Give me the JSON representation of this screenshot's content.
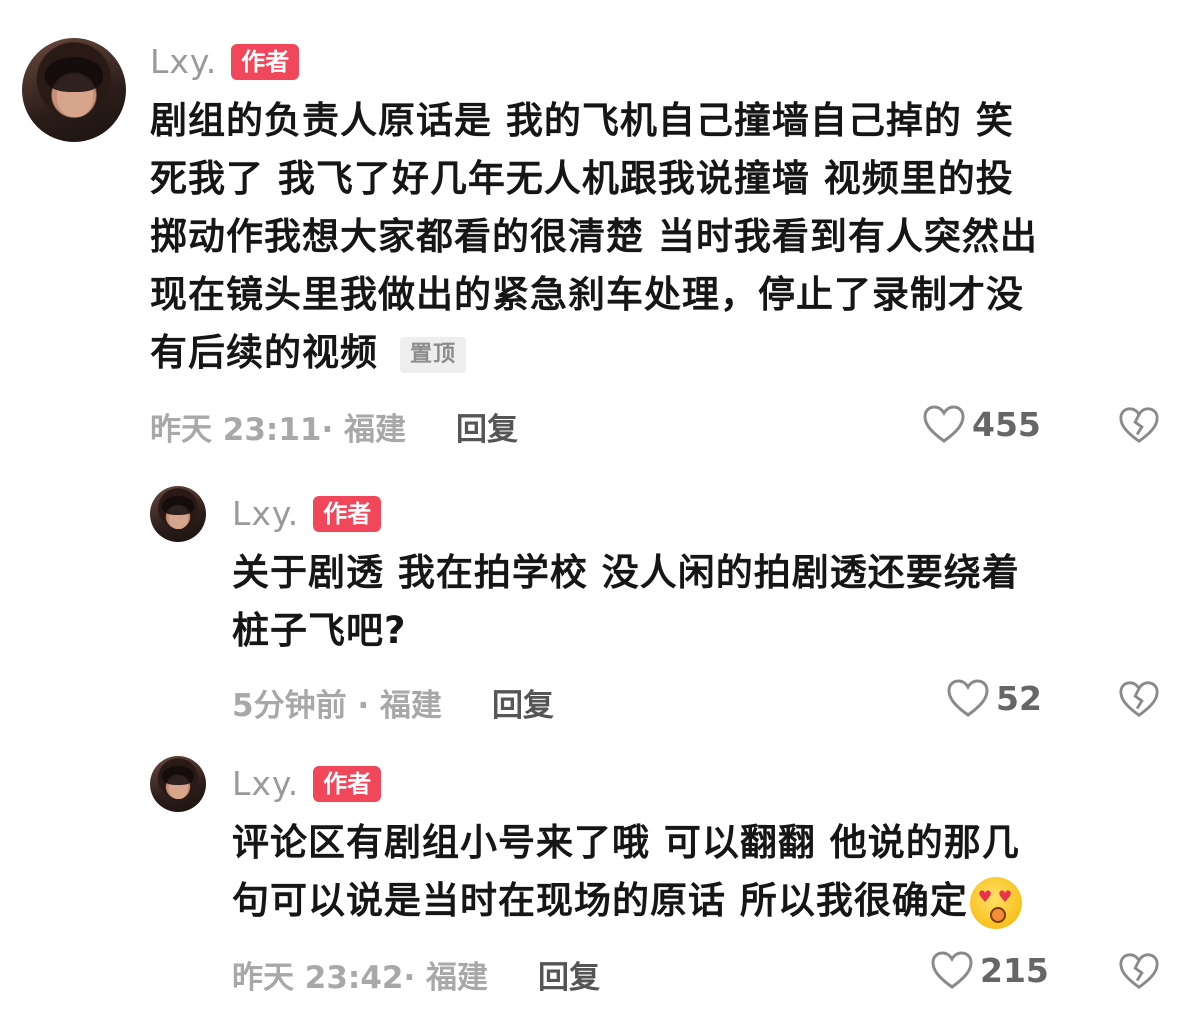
{
  "comments": [
    {
      "username": "Lxy.",
      "author_badge": "作者",
      "lines": [
        "剧组的负责人原话是 我的飞机自己撞墙自己掉的 笑",
        "死我了 我飞了好几年无人机跟我说撞墙 视频里的投",
        "掷动作我想大家都看的很清楚 当时我看到有人突然出",
        "现在镜头里我做出的紧急刹车处理，停止了录制才没",
        "有后续的视频"
      ],
      "pin_badge": "置顶",
      "meta": "昨天 23:11· 福建",
      "reply_label": "回复",
      "likes": "455"
    },
    {
      "username": "Lxy.",
      "author_badge": "作者",
      "lines": [
        "关于剧透 我在拍学校 没人闲的拍剧透还要绕着",
        "桩子飞吧?"
      ],
      "meta": "5分钟前 · 福建",
      "reply_label": "回复",
      "likes": "52"
    },
    {
      "username": "Lxy.",
      "author_badge": "作者",
      "lines": [
        "评论区有剧组小号来了哦 可以翻翻 他说的那几",
        "句可以说是当时在现场的原话 所以我很确定"
      ],
      "emoji": "heart-eyes-emoji",
      "meta": "昨天 23:42· 福建",
      "reply_label": "回复",
      "likes": "215"
    }
  ],
  "colors": {
    "author_badge_bg": "#f0485a",
    "meta_text": "#a8a8a8",
    "content_text": "#161616"
  }
}
